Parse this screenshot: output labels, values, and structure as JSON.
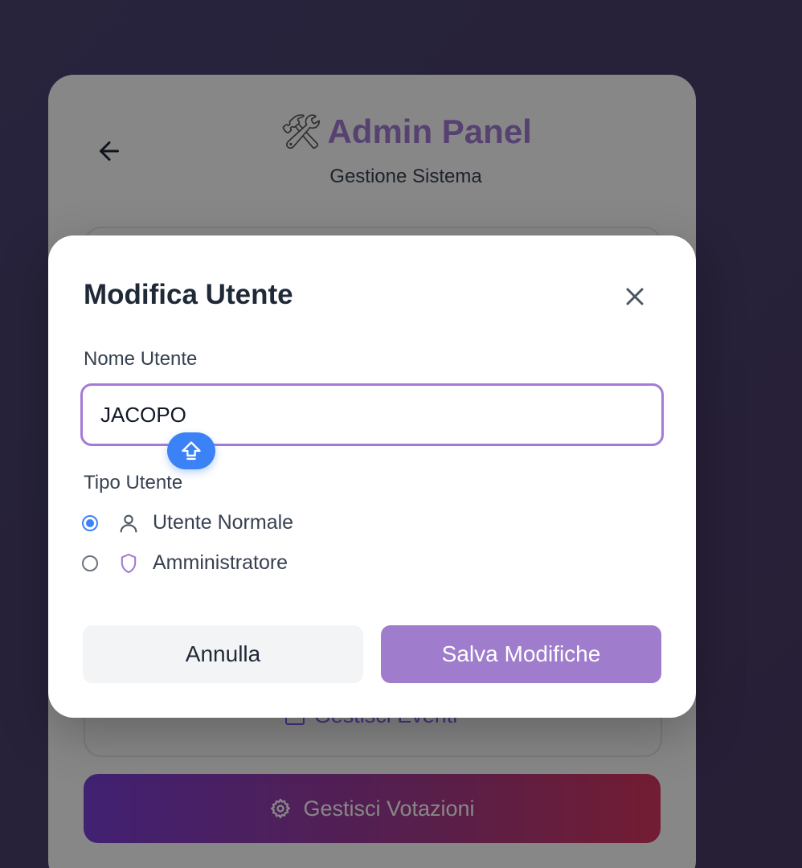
{
  "background": {
    "panel_title": "Admin Panel",
    "panel_title_emoji": "🛠",
    "panel_subtitle": "Gestione Sistema",
    "events_button_label": "Gestisci Eventi",
    "votes_button_label": "Gestisci Votazioni",
    "icons": [
      "arrow-left-icon",
      "calendar-icon",
      "gear-icon"
    ]
  },
  "modal": {
    "title": "Modifica Utente",
    "name_label": "Nome Utente",
    "name_value": "JACOPO",
    "type_label": "Tipo Utente",
    "options": [
      {
        "label": "Utente Normale",
        "icon": "user-icon",
        "selected": true
      },
      {
        "label": "Amministratore",
        "icon": "shield-icon",
        "selected": false
      }
    ],
    "cancel_label": "Annulla",
    "save_label": "Salva Modifiche"
  },
  "colors": {
    "accent": "#a37bd6",
    "radio_selected": "#3b82f6",
    "save_button": "#a07ccc",
    "cancel_button": "#f3f4f6"
  }
}
